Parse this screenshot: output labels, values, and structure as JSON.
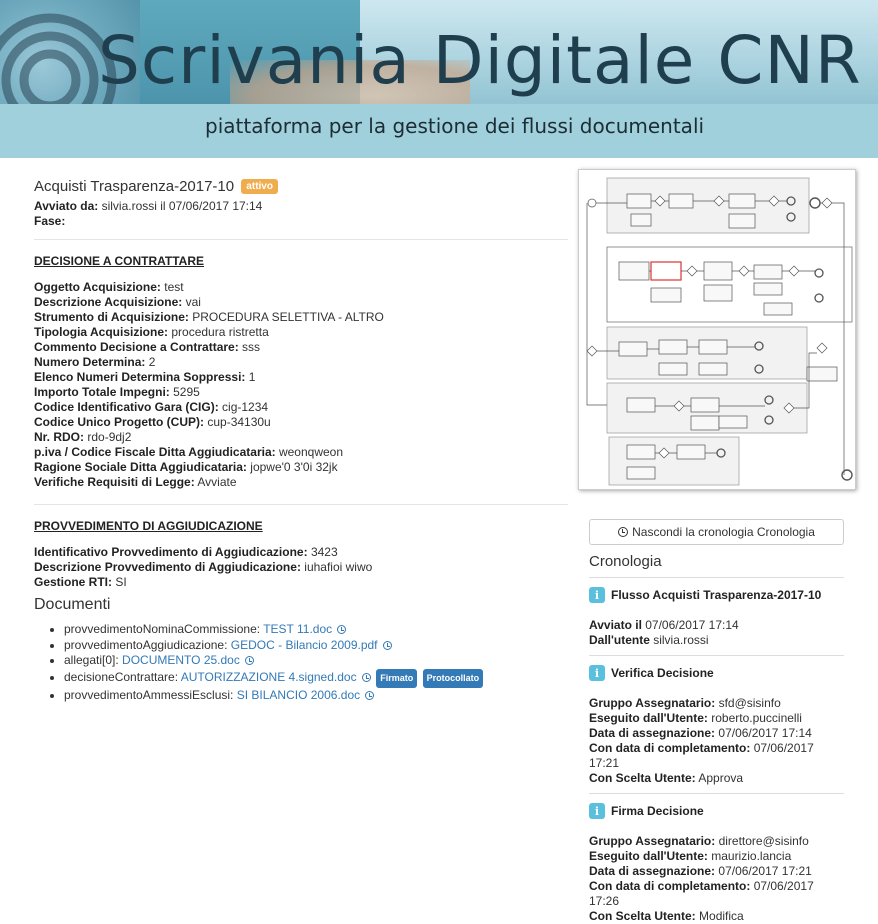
{
  "banner": {
    "title": "Scrivania Digitale CNR",
    "subtitle": "piattaforma per la gestione dei flussi documentali"
  },
  "process": {
    "title": "Acquisti Trasparenza-2017-10",
    "status_badge": "attivo",
    "avviato_label": "Avviato da:",
    "avviato_value": "silvia.rossi il 07/06/2017 17:14",
    "fase_label": "Fase:"
  },
  "decisione": {
    "title": "DECISIONE A CONTRATTARE",
    "fields": [
      {
        "label": "Oggetto Acquisizione:",
        "value": "test"
      },
      {
        "label": "Descrizione Acquisizione:",
        "value": "vai"
      },
      {
        "label": "Strumento di Acquisizione:",
        "value": "PROCEDURA SELETTIVA - ALTRO"
      },
      {
        "label": "Tipologia Acquisizione:",
        "value": "procedura ristretta"
      },
      {
        "label": "Commento Decisione a Contrattare:",
        "value": "sss"
      },
      {
        "label": "Numero Determina:",
        "value": "2"
      },
      {
        "label": "Elenco Numeri Determina Soppressi:",
        "value": "1"
      },
      {
        "label": "Importo Totale Impegni:",
        "value": "5295"
      },
      {
        "label": "Codice Identificativo Gara (CIG):",
        "value": "cig-1234"
      },
      {
        "label": "Codice Unico Progetto (CUP):",
        "value": "cup-34130u"
      },
      {
        "label": "Nr. RDO:",
        "value": "rdo-9dj2"
      },
      {
        "label": "p.iva / Codice Fiscale Ditta Aggiudicataria:",
        "value": "weonqweon"
      },
      {
        "label": "Ragione Sociale Ditta Aggiudicataria:",
        "value": "jopwe'0 3'0i 32jk"
      },
      {
        "label": "Verifiche Requisiti di Legge:",
        "value": "Avviate"
      }
    ]
  },
  "provvedimento": {
    "title": "PROVVEDIMENTO DI AGGIUDICAZIONE",
    "fields": [
      {
        "label": "Identificativo Provvedimento di Aggiudicazione:",
        "value": "3423"
      },
      {
        "label": "Descrizione Provvedimento di Aggiudicazione:",
        "value": "iuhafioi wiwo"
      },
      {
        "label": "Gestione RTI:",
        "value": "SI"
      }
    ]
  },
  "documenti": {
    "title": "Documenti",
    "items": [
      {
        "label": "provvedimentoNominaCommissione:",
        "link": "TEST 11.doc",
        "badges": []
      },
      {
        "label": "provvedimentoAggiudicazione:",
        "link": "GEDOC - Bilancio 2009.pdf",
        "badges": []
      },
      {
        "label": "allegati[0]:",
        "link": "DOCUMENTO 25.doc",
        "badges": []
      },
      {
        "label": "decisioneContrattare:",
        "link": "AUTORIZZAZIONE 4.signed.doc",
        "badges": [
          "Firmato",
          "Protocollato"
        ]
      },
      {
        "label": "provvedimentoAmmessiEsclusi:",
        "link": "SI BILANCIO 2006.doc",
        "badges": []
      }
    ]
  },
  "cronologia": {
    "toggle_button": "Nascondi la cronologia Cronologia",
    "title": "Cronologia",
    "events": [
      {
        "title": "Flusso Acquisti Trasparenza-2017-10",
        "fields": [
          {
            "label": "Avviato il",
            "value": "07/06/2017 17:14"
          },
          {
            "label": "Dall'utente",
            "value": "silvia.rossi"
          }
        ]
      },
      {
        "title": "Verifica Decisione",
        "fields": [
          {
            "label": "Gruppo Assegnatario:",
            "value": "sfd@sisinfo"
          },
          {
            "label": "Eseguito dall'Utente:",
            "value": "roberto.puccinelli"
          },
          {
            "label": "Data di assegnazione:",
            "value": "07/06/2017 17:14"
          },
          {
            "label": "Con data di completamento:",
            "value": "07/06/2017 17:21"
          },
          {
            "label": "Con Scelta Utente:",
            "value": "Approva"
          }
        ]
      },
      {
        "title": "Firma Decisione",
        "fields": [
          {
            "label": "Gruppo Assegnatario:",
            "value": "direttore@sisinfo"
          },
          {
            "label": "Eseguito dall'Utente:",
            "value": "maurizio.lancia"
          },
          {
            "label": "Data di assegnazione:",
            "value": "07/06/2017 17:21"
          },
          {
            "label": "Con data di completamento:",
            "value": "07/06/2017 17:26"
          },
          {
            "label": "Con Scelta Utente:",
            "value": "Modifica"
          }
        ]
      }
    ]
  },
  "colors": {
    "link": "#337ab7",
    "badge_attivo": "#f0ad4e",
    "info_icon": "#5bc0de",
    "label_primary": "#337ab7"
  }
}
